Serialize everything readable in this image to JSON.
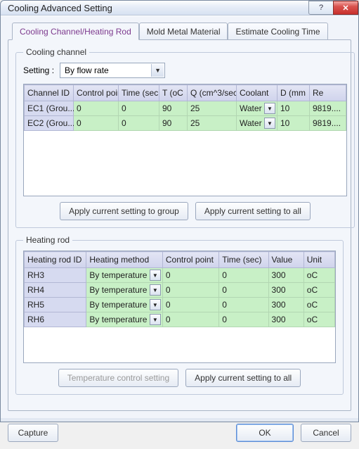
{
  "window": {
    "title": "Cooling Advanced Setting"
  },
  "tabs": [
    {
      "label": "Cooling Channel/Heating Rod"
    },
    {
      "label": "Mold Metal Material"
    },
    {
      "label": "Estimate Cooling Time"
    }
  ],
  "cooling": {
    "group_label": "Cooling channel",
    "setting_label": "Setting :",
    "setting_value": "By flow rate",
    "headers": {
      "channel_id": "Channel ID",
      "control_point": "Control poin",
      "time_sec": "Time (sec",
      "t_oc": "T (oC",
      "q": "Q (cm^3/sec",
      "coolant": "Coolant",
      "d_mm": "D (mm",
      "re": "Re"
    },
    "rows": [
      {
        "channel_id": "EC1 (Grou...",
        "control_point": "0",
        "time_sec": "0",
        "t_oc": "90",
        "q": "25",
        "coolant": "Water",
        "d_mm": "10",
        "re": "9819...."
      },
      {
        "channel_id": "EC2 (Grou...",
        "control_point": "0",
        "time_sec": "0",
        "t_oc": "90",
        "q": "25",
        "coolant": "Water",
        "d_mm": "10",
        "re": "9819...."
      }
    ],
    "apply_group": "Apply current setting to group",
    "apply_all": "Apply current setting to all"
  },
  "heating": {
    "group_label": "Heating rod",
    "headers": {
      "id": "Heating rod ID",
      "method": "Heating method",
      "control_point": "Control point",
      "time_sec": "Time (sec)",
      "value": "Value",
      "unit": "Unit"
    },
    "rows": [
      {
        "id": "RH3",
        "method": "By temperature",
        "control_point": "0",
        "time_sec": "0",
        "value": "300",
        "unit": "oC"
      },
      {
        "id": "RH4",
        "method": "By temperature",
        "control_point": "0",
        "time_sec": "0",
        "value": "300",
        "unit": "oC"
      },
      {
        "id": "RH5",
        "method": "By temperature",
        "control_point": "0",
        "time_sec": "0",
        "value": "300",
        "unit": "oC"
      },
      {
        "id": "RH6",
        "method": "By temperature",
        "control_point": "0",
        "time_sec": "0",
        "value": "300",
        "unit": "oC"
      }
    ],
    "temp_ctrl": "Temperature control setting",
    "apply_all": "Apply current setting to all"
  },
  "footer": {
    "capture": "Capture",
    "ok": "OK",
    "cancel": "Cancel"
  }
}
